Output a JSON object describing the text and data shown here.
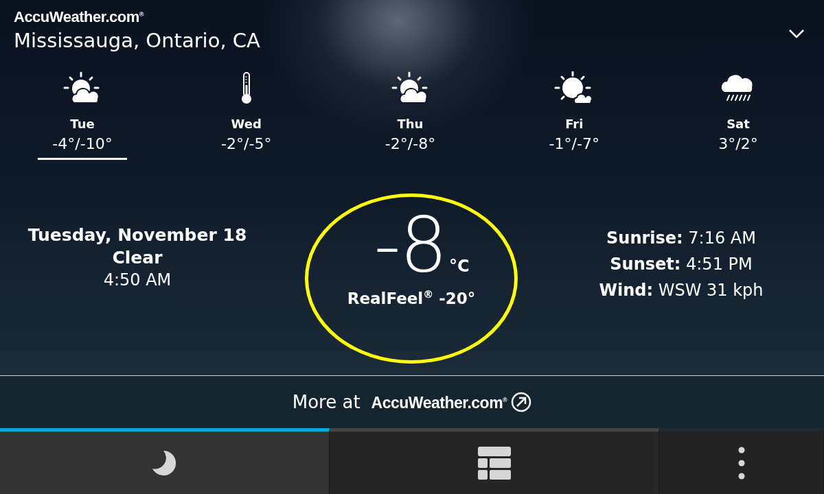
{
  "header": {
    "logo": "AccuWeather.com$^{®}$",
    "location": "Mississauga, Ontario, CA"
  },
  "forecast": [
    {
      "day": "Tue",
      "temps": "-4°/-10°",
      "kind": "cloudsun",
      "selected": true
    },
    {
      "day": "Wed",
      "temps": "-2°/-5°",
      "kind": "thermometer",
      "selected": false
    },
    {
      "day": "Thu",
      "temps": "-2°/-8°",
      "kind": "cloudsun",
      "selected": false
    },
    {
      "day": "Fri",
      "temps": "-1°/-7°",
      "kind": "sunny",
      "selected": false
    },
    {
      "day": "Sat",
      "temps": "3°/2°",
      "kind": "rain",
      "selected": false
    }
  ],
  "conditions": {
    "date": "Tuesday, November 18",
    "summary": "Clear",
    "time": "4:50 AM"
  },
  "current": {
    "temperature": "-8",
    "unit": "°C",
    "realfeel": "RealFeel$^{®}$ -20°",
    "circled": true
  },
  "details": [
    "**Sunrise:** 7:16 AM",
    "**Sunset:** 4:51 PM",
    "**Wind:** WSW 31 kph"
  ],
  "more_link": {
    "label": "More at",
    "brand": "AccuWeather.com$^{®}$"
  },
  "tabs": [
    {
      "kind": "moon",
      "selected": true
    },
    {
      "kind": "grid",
      "selected": false
    }
  ]
}
